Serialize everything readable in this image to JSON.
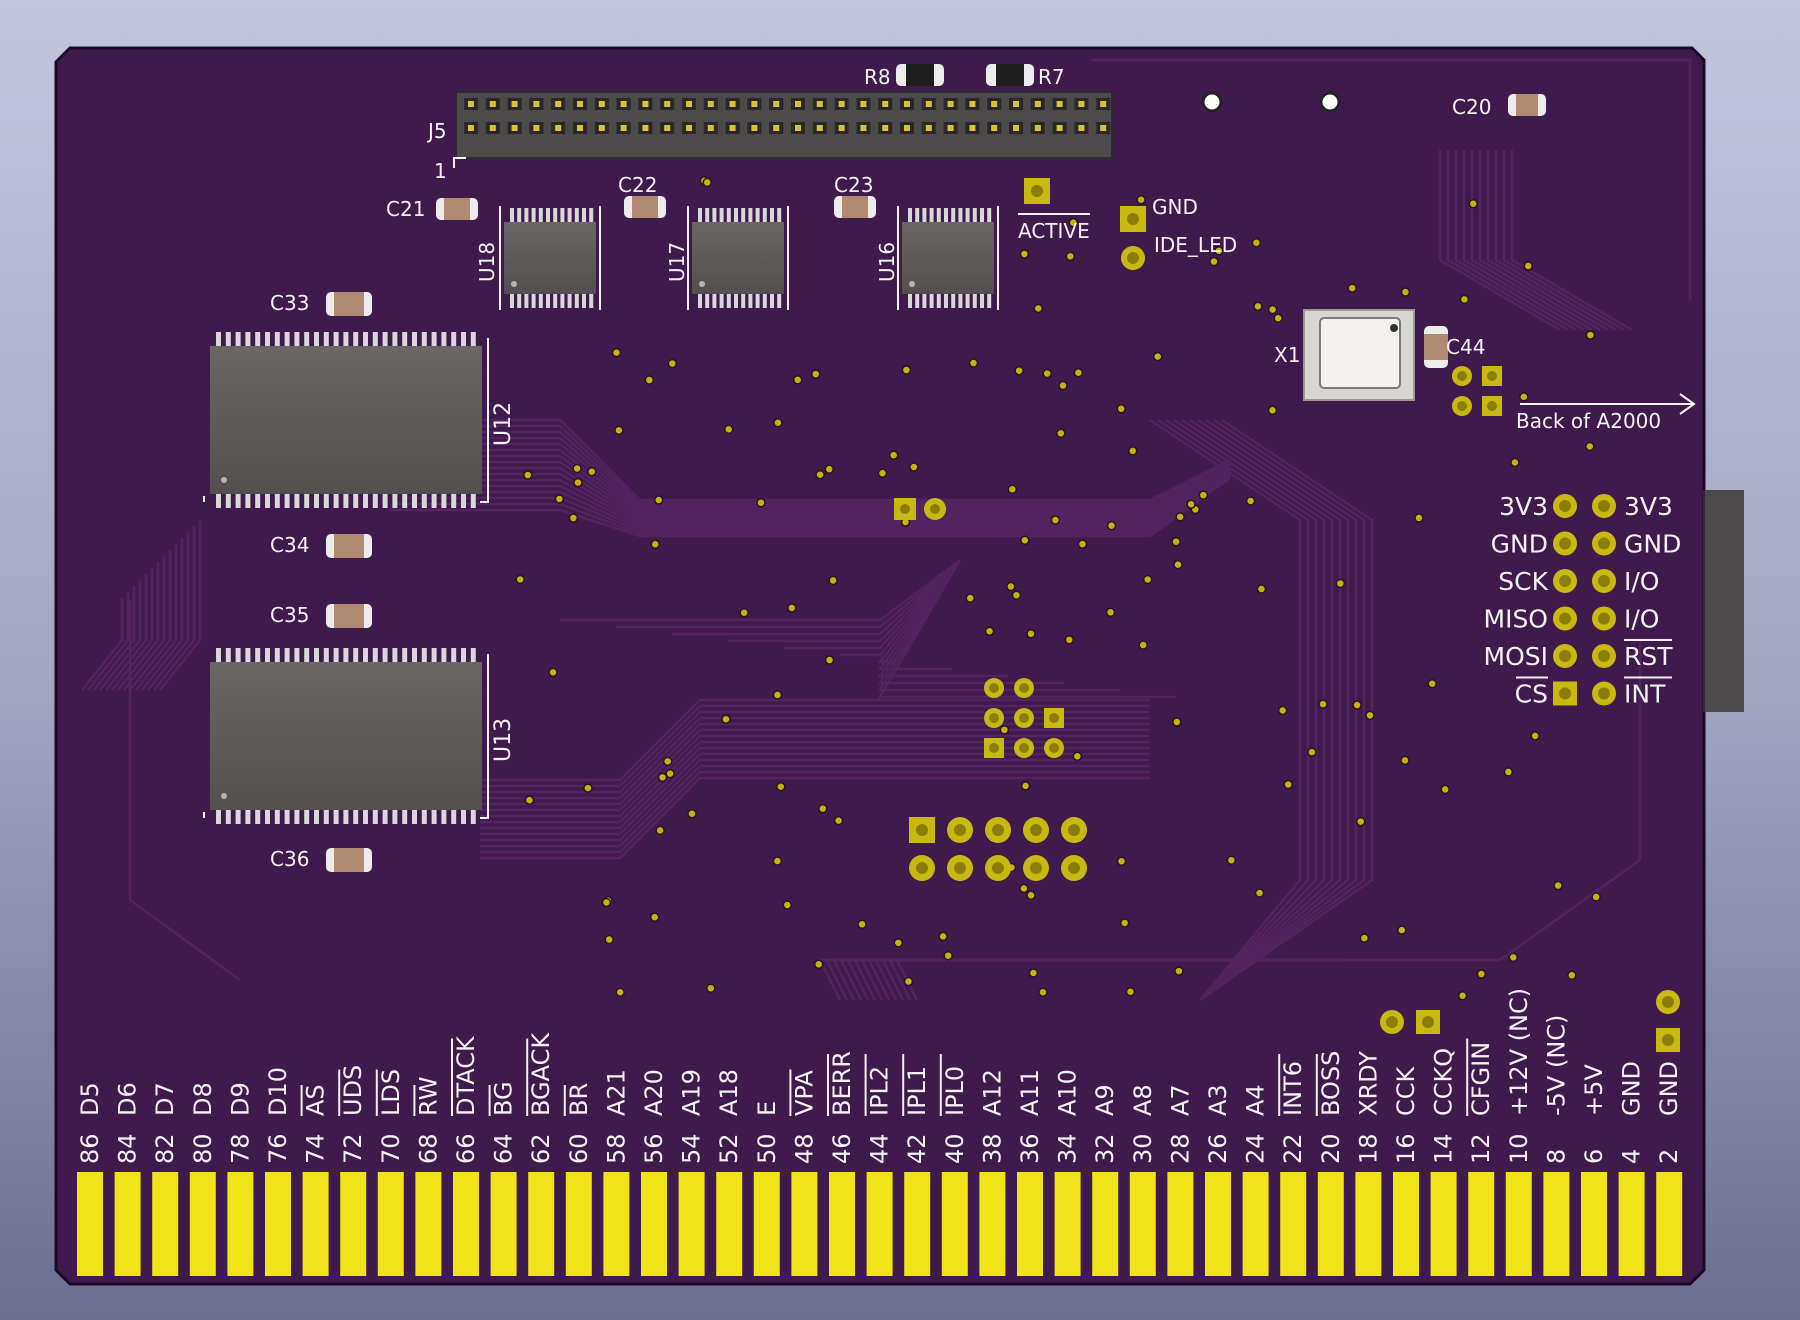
{
  "colors": {
    "board": "#3f1a4c",
    "board_edge": "#1c0a22",
    "trace": "#52235f",
    "silk": "#f2f2f2",
    "gold": "#f1e21a",
    "pad": "#c9b810",
    "ic_body": "#5e5a5a",
    "connector": "#4c4a4a"
  },
  "board": {
    "pcb_label": "Back of A2000",
    "j5": {
      "ref": "J5",
      "pin1": "1"
    },
    "refs": {
      "r8": "R8",
      "r7": "R7",
      "c20": "C20",
      "c21": "C21",
      "c22": "C22",
      "c23": "C23",
      "u18": "U18",
      "u17": "U17",
      "u16": "U16",
      "c33": "C33",
      "u12": "U12",
      "c34": "C34",
      "c35": "C35",
      "u13": "U13",
      "c36": "C36",
      "x1": "X1",
      "c44": "C44"
    },
    "led": {
      "active": "ACTIVE",
      "gnd": "GND",
      "ide_led": "IDE_LED"
    },
    "spi_header": {
      "left": [
        "3V3",
        "GND",
        "SCK",
        "MISO",
        "MOSI",
        "CS"
      ],
      "right": [
        "3V3",
        "GND",
        "I/O",
        "I/O",
        "RST",
        "INT"
      ]
    },
    "edge_pins": {
      "numbers": [
        "86",
        "84",
        "82",
        "80",
        "78",
        "76",
        "74",
        "72",
        "70",
        "68",
        "66",
        "64",
        "62",
        "60",
        "58",
        "56",
        "54",
        "52",
        "50",
        "48",
        "46",
        "44",
        "42",
        "40",
        "38",
        "36",
        "34",
        "32",
        "30",
        "28",
        "26",
        "24",
        "22",
        "20",
        "18",
        "16",
        "14",
        "12",
        "10",
        "8",
        "6",
        "4",
        "2"
      ],
      "signals": [
        "D5",
        "D6",
        "D7",
        "D8",
        "D9",
        "D10",
        "AS",
        "UDS",
        "LDS",
        "RW",
        "DTACK",
        "BG",
        "BGACK",
        "BR",
        "A21",
        "A20",
        "A19",
        "A18",
        "E",
        "VPA",
        "BERR",
        "IPL2",
        "IPL1",
        "IPL0",
        "A12",
        "A11",
        "A10",
        "A9",
        "A8",
        "A7",
        "A3",
        "A4",
        "INT6",
        "BOSS",
        "XRDY",
        "CCK",
        "CCKQ",
        "CFGIN",
        "+12V (NC)",
        "-5V (NC)",
        "+5V",
        "GND",
        "GND"
      ],
      "overlined": [
        "AS",
        "UDS",
        "LDS",
        "RW",
        "DTACK",
        "BG",
        "BGACK",
        "BR",
        "VPA",
        "BERR",
        "IPL2",
        "IPL1",
        "IPL0",
        "INT6",
        "BOSS",
        "CFGIN"
      ]
    }
  }
}
